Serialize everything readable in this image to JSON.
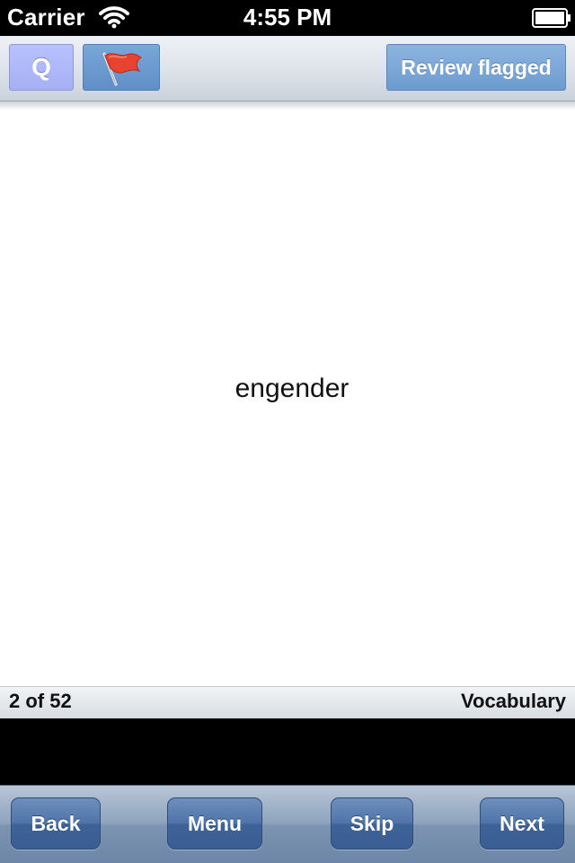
{
  "status_bar": {
    "carrier": "Carrier",
    "time": "4:55 PM",
    "icons": [
      "wifi-icon",
      "battery-icon"
    ]
  },
  "toolbar": {
    "q_label": "Q",
    "flag_icon": "red-flag-icon",
    "review_label": "Review flagged"
  },
  "card": {
    "word": "engender"
  },
  "footer": {
    "progress": "2 of 52",
    "category": "Vocabulary"
  },
  "nav": {
    "back_label": "Back",
    "menu_label": "Menu",
    "skip_label": "Skip",
    "next_label": "Next"
  },
  "colors": {
    "q_button": "#a6b0f2",
    "flag_button": "#6d9bd0",
    "nav_button": "#4f74a8",
    "flag_red": "#e8432f"
  }
}
